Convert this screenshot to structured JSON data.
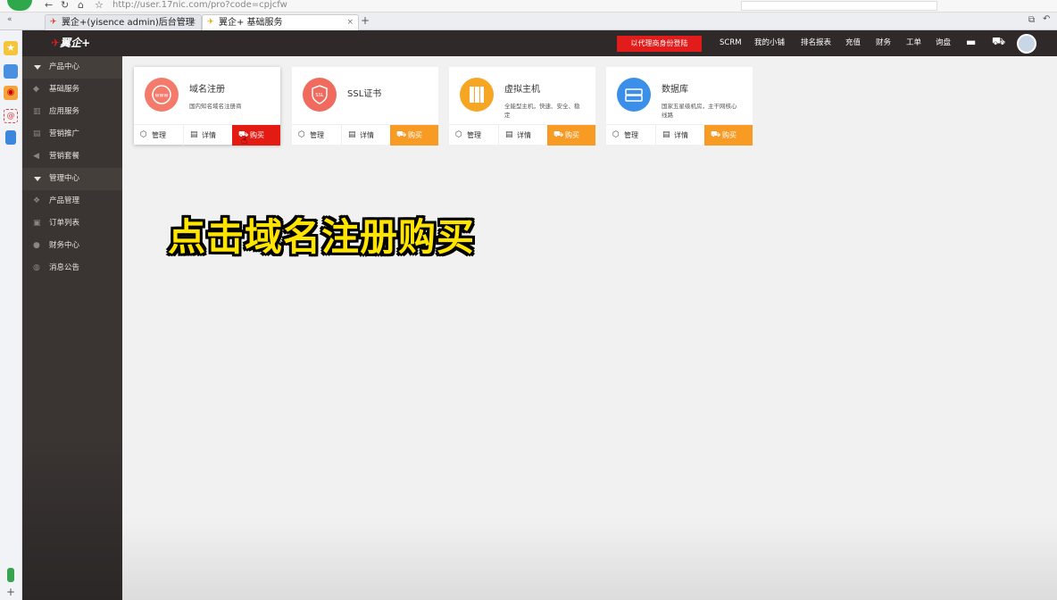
{
  "browser": {
    "url": "http://user.17nic.com/pro?code=cpjcfw",
    "tabs": [
      {
        "label": "翼企+(yisence admin)后台管理"
      },
      {
        "label": "翼企+ 基础服务"
      }
    ]
  },
  "header": {
    "logo": "翼企+",
    "agent_login": "以代理商身份登陆",
    "nav": [
      "SCRM",
      "我的小铺",
      "排名报表",
      "充值",
      "财务",
      "工单",
      "询盘"
    ]
  },
  "sidenav": {
    "sections": [
      {
        "label": "产品中心",
        "items": [
          "基础服务",
          "应用服务",
          "营销推广",
          "营销套餐"
        ]
      },
      {
        "label": "管理中心",
        "items": [
          "产品管理",
          "订单列表",
          "财务中心",
          "消息公告"
        ]
      }
    ]
  },
  "cards": [
    {
      "title": "域名注册",
      "desc": "国内知名域名注册商",
      "color": "#f47a6c",
      "icon": "www-globe-icon"
    },
    {
      "title": "SSL证书",
      "desc": "",
      "color": "#f16a5e",
      "icon": "ssl-shield-icon"
    },
    {
      "title": "虚拟主机",
      "desc": "全能型主机，快速、安全、稳定",
      "color": "#f6a623",
      "icon": "server-rack-icon"
    },
    {
      "title": "数据库",
      "desc": "国家五星级机房，主干网核心线路",
      "color": "#3b8fe8",
      "icon": "database-icon"
    }
  ],
  "actions": {
    "manage": "管理",
    "detail": "详情",
    "buy": "购买"
  },
  "caption": "点击域名注册购买"
}
